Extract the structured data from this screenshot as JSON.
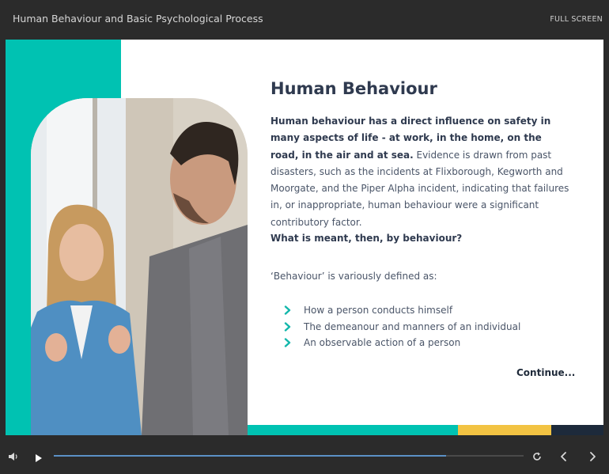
{
  "header": {
    "course_title": "Human Behaviour and Basic Psychological Process",
    "fullscreen_label": "FULL SCREEN"
  },
  "slide": {
    "heading": "Human Behaviour",
    "intro_bold": "Human behaviour has a direct influence on safety in many aspects of life - at work, in the home, on the road, in the air and at sea.",
    "intro_rest": " Evidence is drawn from past disasters, such as the incidents at Flixborough, Kegworth and Moorgate, and the Piper Alpha incident, indicating that failures in, or inappropriate, human behaviour were a significant contributory factor.",
    "question": "What is meant, then, by behaviour?",
    "defined_as": "‘Behaviour’ is variously defined as:",
    "list": [
      "How a person conducts himself",
      "The demeanour and manners of an individual",
      "An observable action of a person"
    ],
    "continue_label": "Continue...",
    "colors": {
      "teal": "#00c2b2",
      "yellow": "#f2c343",
      "navy": "#1d2a3b",
      "heading": "#2f3a4f"
    }
  },
  "player": {
    "progress": 0.835,
    "icons": [
      "volume-icon",
      "play-icon",
      "replay-icon",
      "previous-icon",
      "next-icon"
    ]
  }
}
